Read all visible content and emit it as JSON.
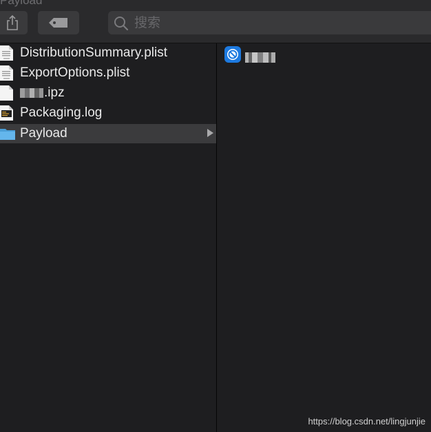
{
  "window": {
    "title": "Payload"
  },
  "toolbar": {
    "share_icon": "share-icon",
    "tag_icon": "tag-icon",
    "search": {
      "placeholder": "搜索",
      "value": ""
    }
  },
  "column1": {
    "items": [
      {
        "label": "DistributionSummary.plist",
        "icon": "plist-file-icon",
        "selected": false
      },
      {
        "label": "ExportOptions.plist",
        "icon": "plist-file-icon",
        "selected": false
      },
      {
        "label": ".ipz",
        "icon": "document-icon",
        "selected": false,
        "name_obscured": true
      },
      {
        "label": "Packaging.log",
        "icon": "log-file-icon",
        "selected": false
      },
      {
        "label": "Payload",
        "icon": "folder-icon",
        "selected": true,
        "has_children": true
      }
    ]
  },
  "column2": {
    "items": [
      {
        "icon": "app-icon",
        "name_obscured": true
      }
    ]
  },
  "watermark": "https://blog.csdn.net/lingjunjie",
  "colors": {
    "background": "#1e1e20",
    "toolbar": "#2a2a2c",
    "selection": "#3b3b3d",
    "folder": "#5aaee6",
    "app_icon": "#1d7ae0"
  }
}
